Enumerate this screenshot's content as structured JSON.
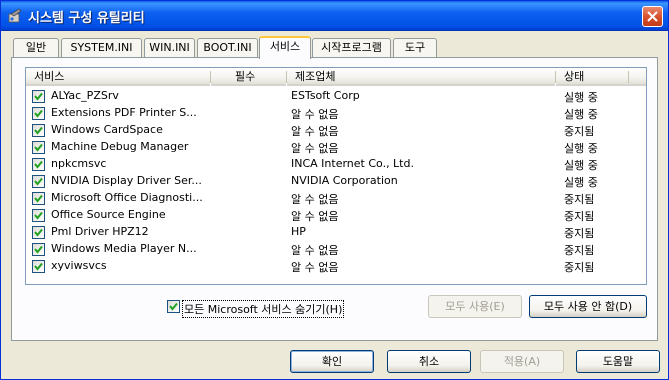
{
  "window": {
    "title": "시스템 구성 유틸리티"
  },
  "tabs": [
    {
      "label": "일반"
    },
    {
      "label": "SYSTEM.INI"
    },
    {
      "label": "WIN.INI"
    },
    {
      "label": "BOOT.INI"
    },
    {
      "label": "서비스",
      "active": true
    },
    {
      "label": "시작프로그램"
    },
    {
      "label": "도구"
    }
  ],
  "columns": {
    "service": "서비스",
    "required": "필수",
    "manufacturer": "제조업체",
    "status": "상태"
  },
  "services": [
    {
      "name": "ALYac_PZSrv",
      "required": "",
      "manufacturer": "ESTsoft Corp",
      "status": "실행 중",
      "checked": true
    },
    {
      "name": "Extensions PDF Printer S...",
      "required": "",
      "manufacturer": "알 수 없음",
      "status": "실행 중",
      "checked": true
    },
    {
      "name": "Windows CardSpace",
      "required": "",
      "manufacturer": "알 수 없음",
      "status": "중지됨",
      "checked": true
    },
    {
      "name": "Machine Debug Manager",
      "required": "",
      "manufacturer": "알 수 없음",
      "status": "실행 중",
      "checked": true
    },
    {
      "name": "npkcmsvc",
      "required": "",
      "manufacturer": "INCA Internet Co., Ltd.",
      "status": "실행 중",
      "checked": true
    },
    {
      "name": "NVIDIA Display Driver Ser...",
      "required": "",
      "manufacturer": "NVIDIA Corporation",
      "status": "실행 중",
      "checked": true
    },
    {
      "name": "Microsoft Office Diagnosti...",
      "required": "",
      "manufacturer": "알 수 없음",
      "status": "중지됨",
      "checked": true
    },
    {
      "name": "Office Source Engine",
      "required": "",
      "manufacturer": "알 수 없음",
      "status": "중지됨",
      "checked": true
    },
    {
      "name": "Pml Driver HPZ12",
      "required": "",
      "manufacturer": "HP",
      "status": "중지됨",
      "checked": true
    },
    {
      "name": "Windows Media Player N...",
      "required": "",
      "manufacturer": "알 수 없음",
      "status": "중지됨",
      "checked": true
    },
    {
      "name": "xyviwsvcs",
      "required": "",
      "manufacturer": "알 수 없음",
      "status": "중지됨",
      "checked": true
    }
  ],
  "hide_ms": {
    "label": "모든 Microsoft 서비스 숨기기(H)",
    "checked": true
  },
  "buttons": {
    "enable_all": "모두 사용(E)",
    "disable_all": "모두 사용 안 함(D)",
    "ok": "확인",
    "cancel": "취소",
    "apply": "적용(A)",
    "help": "도움말"
  },
  "colors": {
    "titlebar": "#0050e6",
    "window_bg": "#ece9d8",
    "tab_highlight": "#ffc83c",
    "checkmark": "#21a121"
  }
}
